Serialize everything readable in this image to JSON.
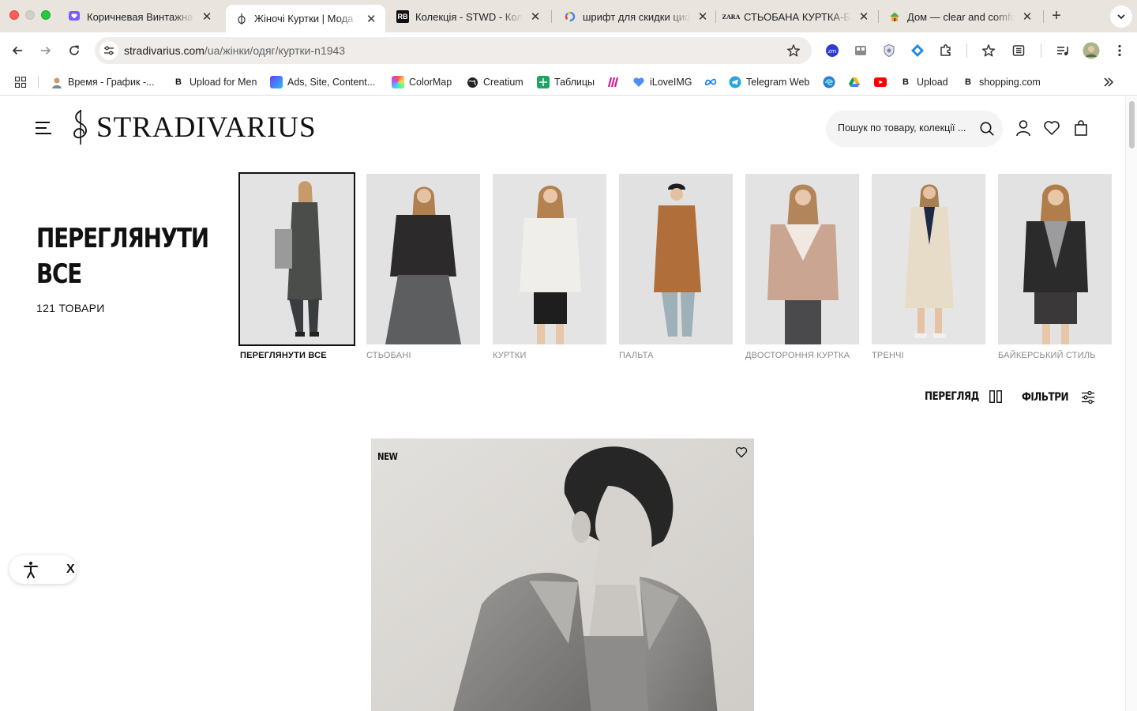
{
  "browser": {
    "tabs": [
      {
        "title": "Коричневая Винтажная",
        "favicon": "heart-chat-icon",
        "active": false
      },
      {
        "title": "Жіночі Куртки | Мода З",
        "favicon": "stradivarius-clef-icon",
        "active": true
      },
      {
        "title": "Колекція - STWD - Кол",
        "favicon": "stwd-logo-icon",
        "active": false
      },
      {
        "title": "шрифт для скидки циф",
        "favicon": "google-icon",
        "active": false
      },
      {
        "title": "СТЬОБАНА КУРТКА-БС",
        "favicon": "zara-logo-icon",
        "active": false
      },
      {
        "title": "Дом — clear and comfo",
        "favicon": "house-icon",
        "active": false
      }
    ],
    "url": {
      "host": "stradivarius.com",
      "path": "/ua/жінки/одяг/куртки-n1943"
    },
    "bookmarks": [
      {
        "label": "Время - График -...",
        "icon": "person-avatar-icon"
      },
      {
        "label": "Upload for Men",
        "icon": "behance-icon"
      },
      {
        "label": "Ads, Site, Content...",
        "icon": "app-icon"
      },
      {
        "label": "ColorMap",
        "icon": "colormap-icon"
      },
      {
        "label": "Creatium",
        "icon": "globe-icon"
      },
      {
        "label": "Таблицы",
        "icon": "sheets-icon"
      },
      {
        "label": "",
        "icon": "miro-icon"
      },
      {
        "label": "iLoveIMG",
        "icon": "heart-icon"
      },
      {
        "label": "",
        "icon": "meta-icon"
      },
      {
        "label": "Telegram Web",
        "icon": "telegram-icon"
      },
      {
        "label": "",
        "icon": "edge-icon"
      },
      {
        "label": "",
        "icon": "google-drive-icon"
      },
      {
        "label": "",
        "icon": "youtube-icon"
      },
      {
        "label": "Upload",
        "icon": "behance-icon"
      },
      {
        "label": "shopping.com",
        "icon": "behance-icon"
      }
    ]
  },
  "header": {
    "logo_text": "STRADIVARIUS",
    "search_placeholder": "Пошук по товару, колекції ..."
  },
  "categories_intro": {
    "title": "ПЕРЕГЛЯНУТИ ВСЕ",
    "count": "121 ТОВАРИ"
  },
  "categories": [
    {
      "label": "ПЕРЕГЛЯНУТИ ВСЕ",
      "active": true
    },
    {
      "label": "СТЬОБАНІ",
      "active": false
    },
    {
      "label": "КУРТКИ",
      "active": false
    },
    {
      "label": "ПАЛЬТА",
      "active": false
    },
    {
      "label": "ДВОСТОРОННЯ КУРТКА",
      "active": false
    },
    {
      "label": "ТРЕНЧІ",
      "active": false
    },
    {
      "label": "БАЙКЕРСЬКИЙ СТИЛЬ",
      "active": false
    }
  ],
  "controls": {
    "view_label": "ПЕРЕГЛЯД",
    "filters_label": "ФІЛЬТРИ"
  },
  "products": [
    {
      "badge": "NEW"
    }
  ],
  "accessibility_widget": {
    "close_label": "X"
  },
  "colors": {
    "tabstrip_bg": "#e9e4de",
    "omnibox_bg": "#efece9",
    "text_primary": "#111111",
    "text_muted": "#8a8a8a",
    "search_bg": "#f4f4f4"
  }
}
